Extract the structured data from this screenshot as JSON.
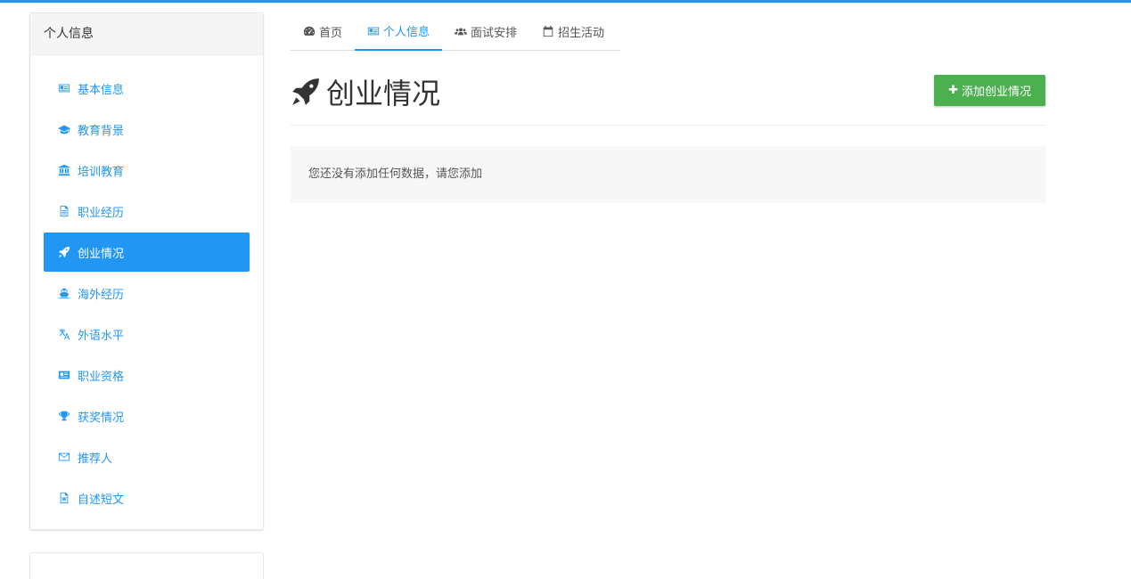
{
  "colors": {
    "accent": "#2196f3",
    "success": "#4caf50"
  },
  "sidebar": {
    "header": "个人信息",
    "items": [
      {
        "label": "基本信息",
        "icon": "id-card-icon",
        "active": false
      },
      {
        "label": "教育背景",
        "icon": "graduation-cap-icon",
        "active": false
      },
      {
        "label": "培训教育",
        "icon": "institution-icon",
        "active": false
      },
      {
        "label": "职业经历",
        "icon": "file-text-icon",
        "active": false
      },
      {
        "label": "创业情况",
        "icon": "rocket-icon",
        "active": true
      },
      {
        "label": "海外经历",
        "icon": "ship-icon",
        "active": false
      },
      {
        "label": "外语水平",
        "icon": "language-icon",
        "active": false
      },
      {
        "label": "职业资格",
        "icon": "vcard-icon",
        "active": false
      },
      {
        "label": "获奖情况",
        "icon": "trophy-icon",
        "active": false
      },
      {
        "label": "推荐人",
        "icon": "envelope-icon",
        "active": false
      },
      {
        "label": "自述短文",
        "icon": "file-word-icon",
        "active": false
      }
    ]
  },
  "tabs": [
    {
      "label": "首页",
      "icon": "dashboard-icon",
      "active": false
    },
    {
      "label": "个人信息",
      "icon": "id-card-icon",
      "active": true
    },
    {
      "label": "面试安排",
      "icon": "users-icon",
      "active": false
    },
    {
      "label": "招生活动",
      "icon": "calendar-icon",
      "active": false
    }
  ],
  "main": {
    "title": "创业情况",
    "title_icon": "rocket-icon",
    "add_button": "添加创业情况",
    "empty_message": "您还没有添加任何数据，请您添加"
  }
}
